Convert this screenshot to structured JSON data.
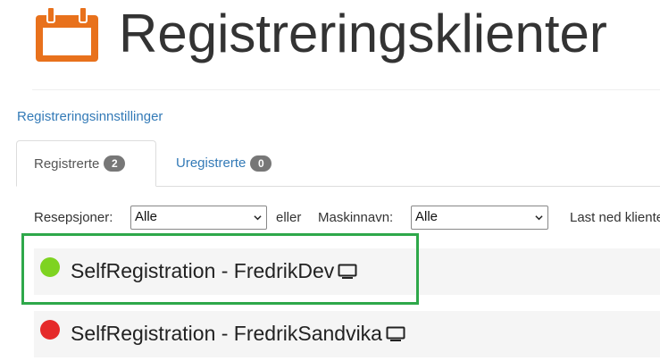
{
  "header": {
    "title": "Registreringsklienter",
    "icon": "calendar-icon",
    "icon_color": "#e8711c"
  },
  "settings_link": "Registreringsinnstillinger",
  "tabs": [
    {
      "label": "Registrerte",
      "count": "2",
      "active": true
    },
    {
      "label": "Uregistrerte",
      "count": "0",
      "active": false
    }
  ],
  "filters": {
    "reception_label": "Resepsjoner:",
    "reception_value": "Alle",
    "or_label": "eller",
    "machine_label": "Maskinnavn:",
    "machine_value": "Alle",
    "download_label": "Last ned klienter"
  },
  "clients": [
    {
      "name": "SelfRegistration - FredrikDev",
      "status": "online",
      "status_color": "#7ed321",
      "icon": "monitor-icon"
    },
    {
      "name": "SelfRegistration - FredrikSandvika",
      "status": "offline",
      "status_color": "#e52a2a",
      "icon": "monitor-icon"
    }
  ],
  "colors": {
    "link": "#337ab7",
    "highlight": "#2ea84a",
    "badge": "#777777"
  }
}
